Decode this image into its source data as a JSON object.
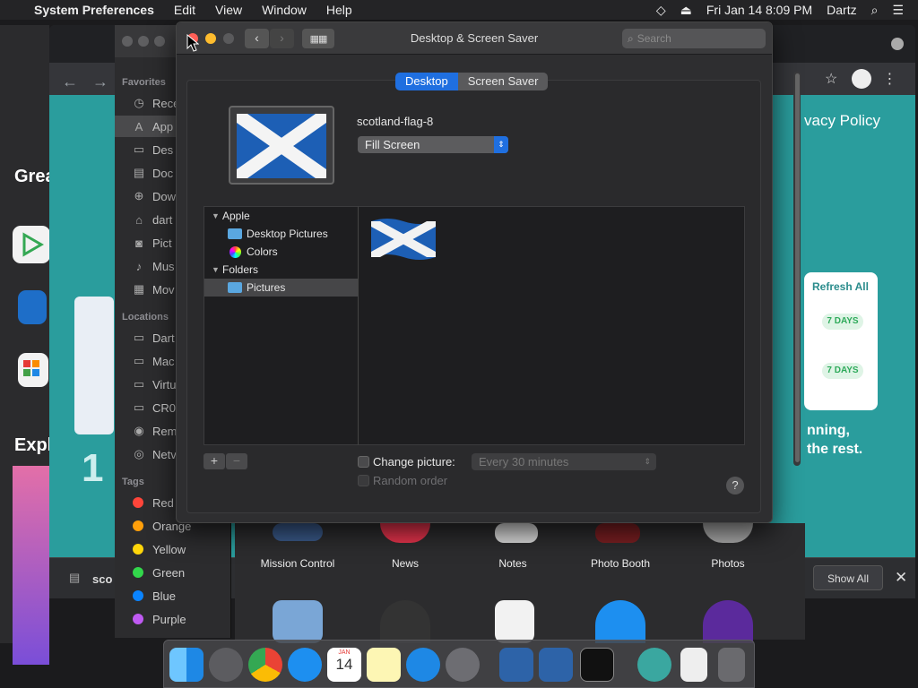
{
  "menubar": {
    "app_name": "System Preferences",
    "items": [
      "Edit",
      "View",
      "Window",
      "Help"
    ],
    "datetime": "Fri Jan 14  8:09 PM",
    "user": "Dartz"
  },
  "finder": {
    "favorites_header": "Favorites",
    "favorites": [
      {
        "label": "Rece",
        "icon": "clock-icon"
      },
      {
        "label": "App",
        "icon": "applications-icon"
      },
      {
        "label": "Des",
        "icon": "desktop-icon"
      },
      {
        "label": "Doc",
        "icon": "document-icon"
      },
      {
        "label": "Dow",
        "icon": "download-icon"
      },
      {
        "label": "dart",
        "icon": "home-icon"
      },
      {
        "label": "Pict",
        "icon": "camera-icon"
      },
      {
        "label": "Mus",
        "icon": "music-icon"
      },
      {
        "label": "Mov",
        "icon": "film-icon"
      }
    ],
    "locations_header": "Locations",
    "locations": [
      {
        "label": "Dart",
        "icon": "computer-icon"
      },
      {
        "label": "Mac",
        "icon": "disk-icon"
      },
      {
        "label": "Virtu",
        "icon": "disk-icon"
      },
      {
        "label": "CR0",
        "icon": "disk-icon"
      },
      {
        "label": "Rem",
        "icon": "disc-icon"
      },
      {
        "label": "Netv",
        "icon": "network-icon"
      }
    ],
    "tags_header": "Tags",
    "tags": [
      {
        "label": "Red",
        "color": "#ff453a"
      },
      {
        "label": "Orange",
        "color": "#ff9f0a"
      },
      {
        "label": "Yellow",
        "color": "#ffd60a"
      },
      {
        "label": "Green",
        "color": "#32d74b"
      },
      {
        "label": "Blue",
        "color": "#0a84ff"
      },
      {
        "label": "Purple",
        "color": "#bf5af2"
      }
    ]
  },
  "dialog": {
    "title": "Desktop & Screen Saver",
    "search_placeholder": "Search",
    "tabs": {
      "desktop": "Desktop",
      "screensaver": "Screen Saver"
    },
    "image_name": "scotland-flag-8",
    "fit_option": "Fill Screen",
    "sources": {
      "apple": "Apple",
      "desktop_pictures": "Desktop Pictures",
      "colors": "Colors",
      "folders": "Folders",
      "pictures": "Pictures"
    },
    "add_label": "+",
    "remove_label": "−",
    "change_picture_label": "Change picture:",
    "change_interval": "Every 30 minutes",
    "random_order_label": "Random order",
    "help_label": "?"
  },
  "background": {
    "privacy_text": "vacy Policy",
    "left_heading_1": "Grea",
    "left_heading_2": "Expl",
    "big_digit": "1",
    "refresh_title": "Refresh All",
    "pill_1": "7 DAYS",
    "pill_2": "7 DAYS",
    "bullet_line_1": "nning,",
    "bullet_line_2": "the rest.",
    "download_name": "sco",
    "show_all": "Show All",
    "apps": [
      "Mission Control",
      "News",
      "Notes",
      "Photo Booth",
      "Photos"
    ]
  },
  "dock": {
    "calendar_month": "JAN",
    "calendar_day": "14"
  },
  "colors": {
    "accent": "#1f6fe0",
    "flag_blue": "#1d5fb5",
    "teal_bg": "#2a9d9d"
  }
}
